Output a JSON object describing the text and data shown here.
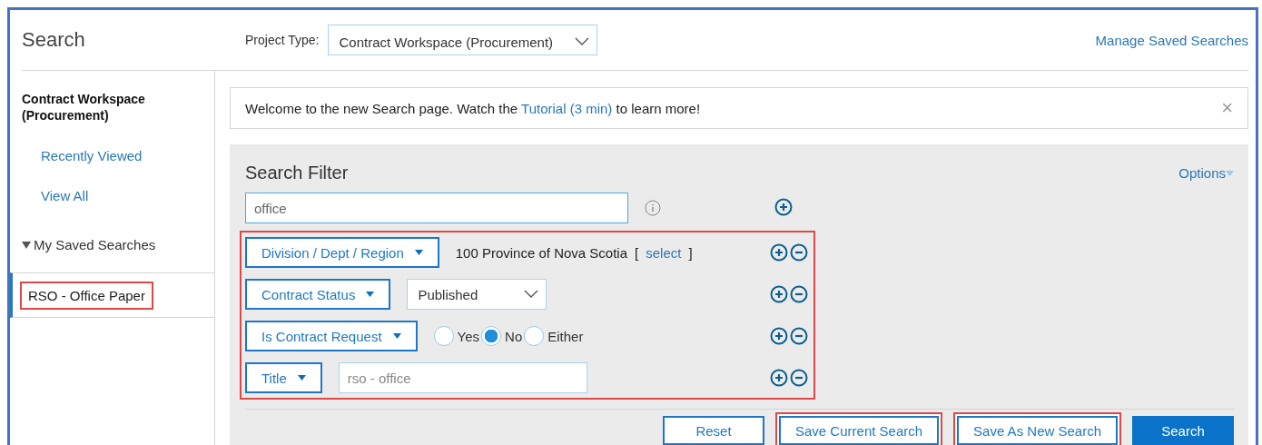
{
  "header": {
    "title": "Search",
    "project_type_label": "Project Type:",
    "project_type_value": "Contract Workspace (Procurement)",
    "manage_link": "Manage Saved Searches"
  },
  "sidebar": {
    "heading": "Contract Workspace (Procurement)",
    "items": [
      {
        "label": "Recently Viewed",
        "selected": false
      },
      {
        "label": "View All",
        "selected": false
      },
      {
        "label": "My Saved Searches",
        "selected": false,
        "expanded": true,
        "children": [
          {
            "label": "RSO - Office Paper",
            "selected": true,
            "highlighted": true
          }
        ]
      }
    ]
  },
  "notice": {
    "text_before": "Welcome to the new Search page. Watch the ",
    "link": "Tutorial (3 min)",
    "text_after": " to learn more!",
    "close": "×"
  },
  "filter": {
    "title": "Search Filter",
    "options_link": "Options",
    "keyword": "office",
    "rows_highlighted": true,
    "rows": [
      {
        "kind": "value",
        "label": "Division / Dept / Region",
        "value": "100 Province of Nova Scotia",
        "bracket_open": "[",
        "link": "select",
        "bracket_close": "]"
      },
      {
        "kind": "dropdown",
        "label": "Contract Status",
        "value": "Published"
      },
      {
        "kind": "radio",
        "label": "Is Contract Request",
        "options": [
          {
            "label": "Yes",
            "selected": false
          },
          {
            "label": "No",
            "selected": true
          },
          {
            "label": "Either",
            "selected": false
          }
        ]
      },
      {
        "kind": "text",
        "label": "Title",
        "placeholder": "rso - office"
      }
    ]
  },
  "buttons": [
    {
      "label": "Reset",
      "kind": "secondary",
      "highlighted": false
    },
    {
      "label": "Save Current Search",
      "kind": "secondary",
      "highlighted": true
    },
    {
      "label": "Save As New Search",
      "kind": "secondary",
      "highlighted": true
    },
    {
      "label": "Search",
      "kind": "primary",
      "highlighted": false
    }
  ]
}
